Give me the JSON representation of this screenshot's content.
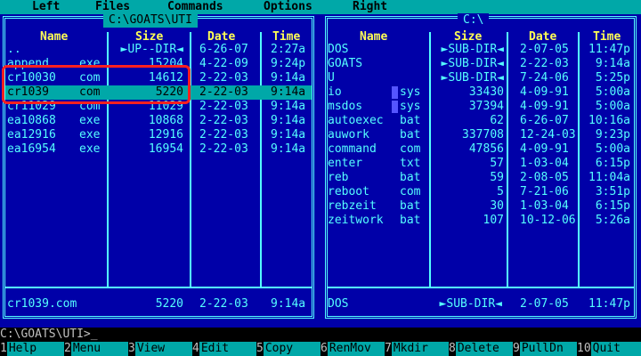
{
  "menu": [
    "Left",
    "Files",
    "Commands",
    "Options",
    "Right"
  ],
  "left_panel": {
    "path": "C:\\GOATS\\UTI",
    "headers": {
      "name": "Name",
      "size": "Size",
      "date": "Date",
      "time": "Time"
    },
    "rows": [
      {
        "name": "..",
        "ext": "",
        "size": "►UP--DIR◄",
        "date": "6-26-07",
        "time": "2:27a"
      },
      {
        "name": "append",
        "ext": "exe",
        "size": "15204",
        "date": "4-22-09",
        "time": "9:24p"
      },
      {
        "name": "cr10030",
        "ext": "com",
        "size": "14612",
        "date": "2-22-03",
        "time": "9:14a"
      },
      {
        "name": "cr1039",
        "ext": "com",
        "size": "5220",
        "date": "2-22-03",
        "time": "9:14a"
      },
      {
        "name": "cr11029",
        "ext": "com",
        "size": "11029",
        "date": "2-22-03",
        "time": "9:14a"
      },
      {
        "name": "ea10868",
        "ext": "exe",
        "size": "10868",
        "date": "2-22-03",
        "time": "9:14a"
      },
      {
        "name": "ea12916",
        "ext": "exe",
        "size": "12916",
        "date": "2-22-03",
        "time": "9:14a"
      },
      {
        "name": "ea16954",
        "ext": "exe",
        "size": "16954",
        "date": "2-22-03",
        "time": "9:14a"
      }
    ],
    "status": {
      "name": "cr1039.com",
      "size": "5220",
      "date": "2-22-03",
      "time": "9:14a"
    }
  },
  "right_panel": {
    "path": "C:\\",
    "headers": {
      "name": "Name",
      "size": "Size",
      "date": "Date",
      "time": "Time"
    },
    "rows": [
      {
        "name": "DOS",
        "ext": "",
        "size": "►SUB-DIR◄",
        "date": "2-07-05",
        "time": "11:47p"
      },
      {
        "name": "GOATS",
        "ext": "",
        "size": "►SUB-DIR◄",
        "date": "2-22-03",
        "time": "9:14a"
      },
      {
        "name": "U",
        "ext": "",
        "size": "►SUB-DIR◄",
        "date": "7-24-06",
        "time": "5:25p"
      },
      {
        "name": "io",
        "ext": "sys",
        "size": "33430",
        "date": "4-09-91",
        "time": "5:00a"
      },
      {
        "name": "msdos",
        "ext": "sys",
        "size": "37394",
        "date": "4-09-91",
        "time": "5:00a"
      },
      {
        "name": "autoexec",
        "ext": "bat",
        "size": "62",
        "date": "6-26-07",
        "time": "10:16a"
      },
      {
        "name": "auwork",
        "ext": "bat",
        "size": "337708",
        "date": "12-24-03",
        "time": "9:23p"
      },
      {
        "name": "command",
        "ext": "com",
        "size": "47856",
        "date": "4-09-91",
        "time": "5:00a"
      },
      {
        "name": "enter",
        "ext": "txt",
        "size": "57",
        "date": "1-03-04",
        "time": "6:15p"
      },
      {
        "name": "reb",
        "ext": "bat",
        "size": "59",
        "date": "2-08-05",
        "time": "11:04a"
      },
      {
        "name": "reboot",
        "ext": "com",
        "size": "5",
        "date": "7-21-06",
        "time": "3:51p"
      },
      {
        "name": "rebzeit",
        "ext": "bat",
        "size": "30",
        "date": "1-03-04",
        "time": "6:15p"
      },
      {
        "name": "zeitwork",
        "ext": "bat",
        "size": "107",
        "date": "10-12-06",
        "time": "5:26a"
      }
    ],
    "status": {
      "name": "DOS",
      "size": "►SUB-DIR◄",
      "date": "2-07-05",
      "time": "11:47p"
    }
  },
  "command_line": "C:\\GOATS\\UTI>_",
  "function_keys": [
    {
      "num": "1",
      "label": "Help"
    },
    {
      "num": "2",
      "label": "Menu"
    },
    {
      "num": "3",
      "label": "View"
    },
    {
      "num": "4",
      "label": "Edit"
    },
    {
      "num": "5",
      "label": "Copy"
    },
    {
      "num": "6",
      "label": "RenMov"
    },
    {
      "num": "7",
      "label": "Mkdir"
    },
    {
      "num": "8",
      "label": "Delete"
    },
    {
      "num": "9",
      "label": "PullDn"
    },
    {
      "num": "10",
      "label": "Quit"
    }
  ],
  "colors": {
    "background": "#0000a8",
    "text": "#55ffff",
    "header": "#ffff55",
    "highlight": "#00a8a8",
    "annotation": "#ff2020"
  }
}
